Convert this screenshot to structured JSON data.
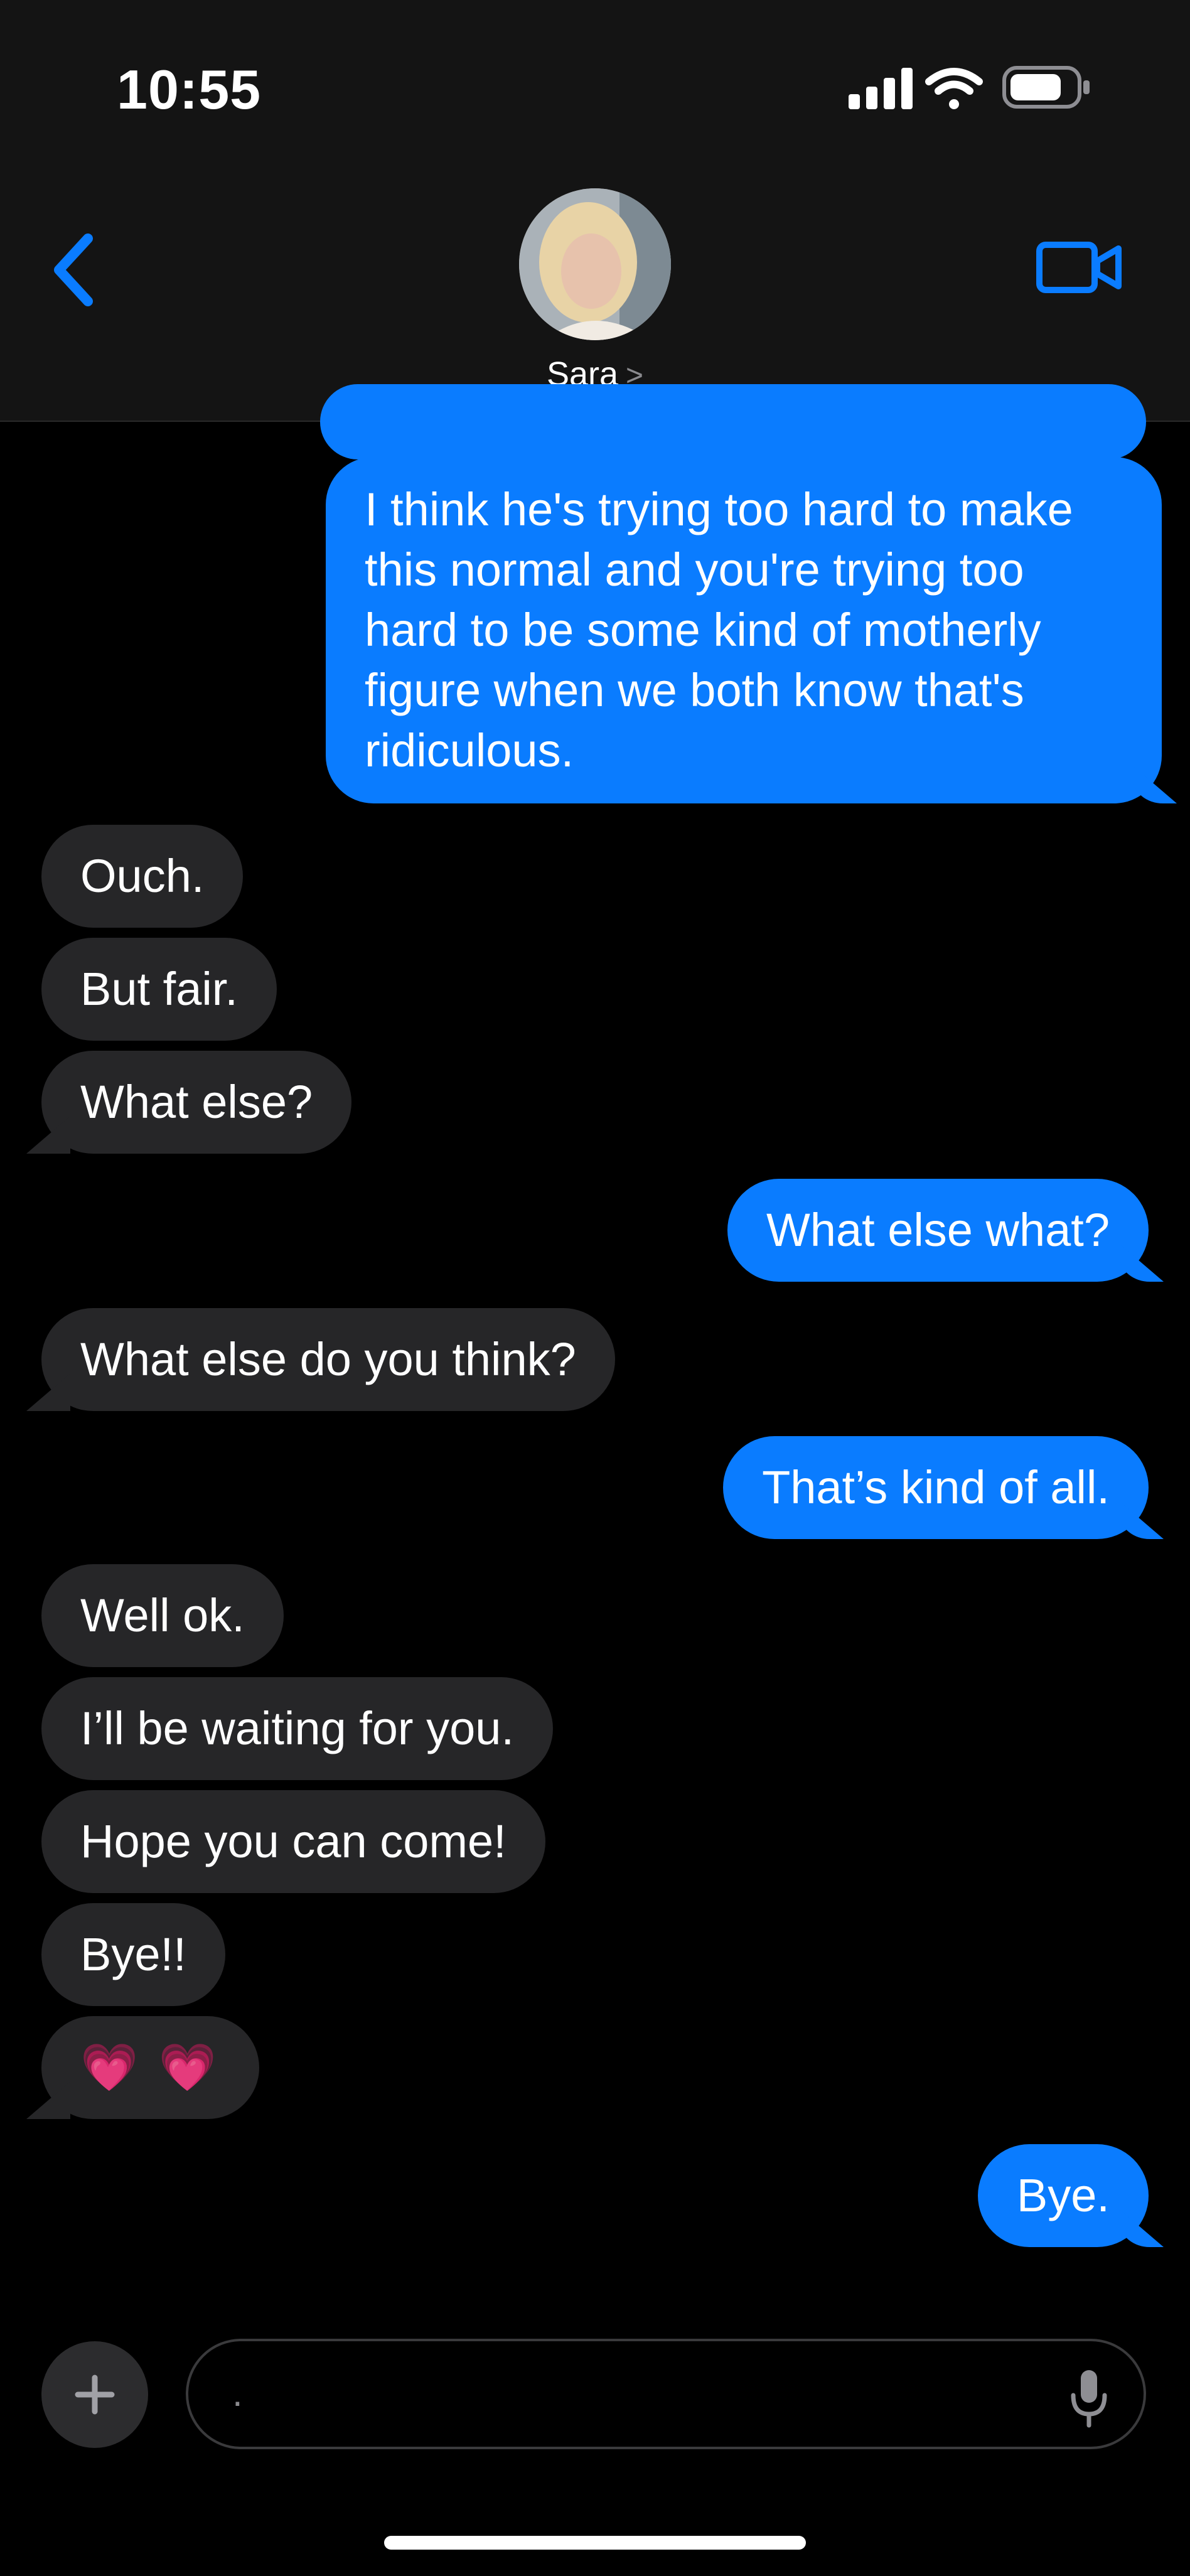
{
  "status": {
    "time": "10:55"
  },
  "header": {
    "contact_name": "Sara",
    "chevron": ">"
  },
  "messages": [
    {
      "side": "out",
      "text": "I think he's trying too hard to make this normal and you're trying too hard to be some kind of motherly figure when we both know that's ridiculous."
    },
    {
      "side": "in",
      "text": "Ouch."
    },
    {
      "side": "in",
      "text": "But fair."
    },
    {
      "side": "in",
      "text": "What else?"
    },
    {
      "side": "out",
      "text": "What else what?"
    },
    {
      "side": "in",
      "text": "What else do you think?"
    },
    {
      "side": "out",
      "text": "That’s kind of all."
    },
    {
      "side": "in",
      "text": "Well ok."
    },
    {
      "side": "in",
      "text": "I’ll be waiting for you."
    },
    {
      "side": "in",
      "text": "Hope you can come!"
    },
    {
      "side": "in",
      "text": "Bye!!"
    },
    {
      "side": "in",
      "text": "💗 💗"
    },
    {
      "side": "out",
      "text": "Bye."
    }
  ],
  "composer": {
    "placeholder": "."
  },
  "icons": {
    "back": "chevron-left-icon",
    "video": "video-camera-icon",
    "plus": "plus-icon",
    "mic": "microphone-icon",
    "signal": "cellular-signal-icon",
    "wifi": "wifi-icon",
    "battery": "battery-icon"
  },
  "colors": {
    "accent": "#0a7cff",
    "incoming": "#262628",
    "background": "#000000"
  }
}
